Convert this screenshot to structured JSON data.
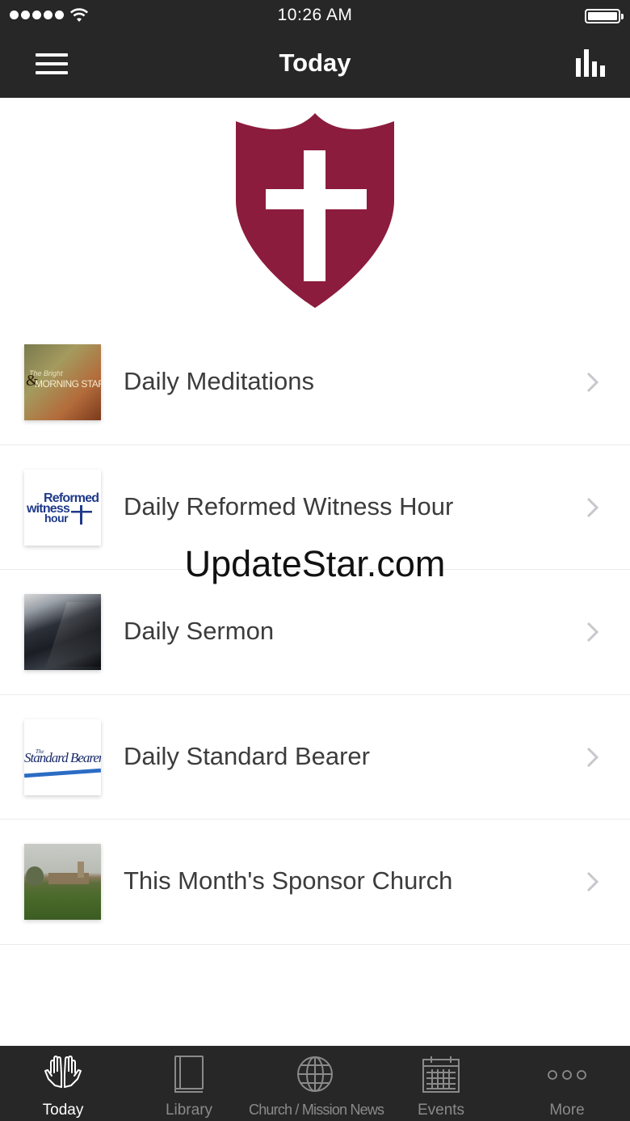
{
  "status_bar": {
    "time": "10:26 AM"
  },
  "header": {
    "title": "Today"
  },
  "colors": {
    "bar": "#272727",
    "shield": "#8c1c3e",
    "tab_active": "#ffffff",
    "tab_inactive": "#8a8a8a"
  },
  "list": {
    "items": [
      {
        "label": "Daily Meditations",
        "thumb_text": [
          "The Bright",
          "&",
          "MORNING STAR"
        ]
      },
      {
        "label": "Daily Reformed Witness Hour",
        "thumb_text": [
          "Reformed",
          "witness",
          "hour"
        ]
      },
      {
        "label": "Daily Sermon"
      },
      {
        "label": "Daily Standard Bearer",
        "thumb_text": [
          "The",
          "Standard Bearer"
        ]
      },
      {
        "label": "This Month's Sponsor Church"
      }
    ]
  },
  "watermark": "UpdateStar.com",
  "tabbar": {
    "tabs": [
      {
        "label": "Today",
        "icon": "praying-hands-icon",
        "active": true
      },
      {
        "label": "Library",
        "icon": "book-icon",
        "active": false
      },
      {
        "label": "Church / Mission News",
        "icon": "globe-icon",
        "active": false
      },
      {
        "label": "Events",
        "icon": "calendar-icon",
        "active": false
      },
      {
        "label": "More",
        "icon": "more-dots-icon",
        "active": false
      }
    ]
  }
}
